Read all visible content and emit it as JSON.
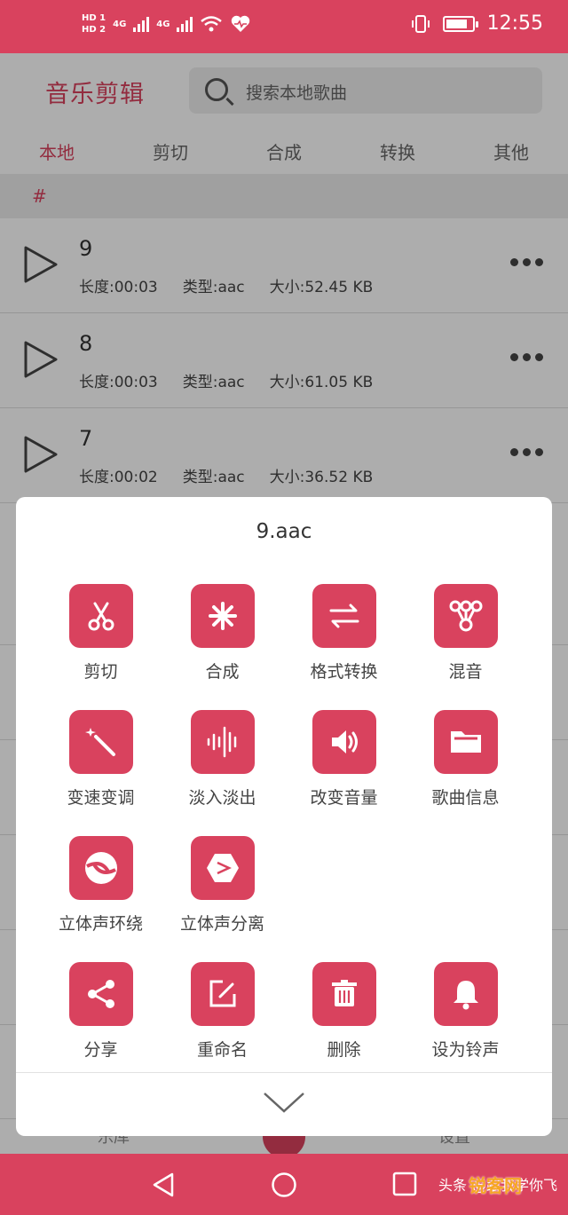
{
  "status_bar": {
    "hd1": "HD 1",
    "hd2": "HD 2",
    "net1": "4G",
    "net2": "4G",
    "battery_level": 0.85,
    "time": "12:55"
  },
  "header": {
    "title": "音乐剪辑",
    "search_placeholder": "搜索本地歌曲"
  },
  "tabs": [
    {
      "label": "本地",
      "active": true
    },
    {
      "label": "剪切",
      "active": false
    },
    {
      "label": "合成",
      "active": false
    },
    {
      "label": "转换",
      "active": false
    },
    {
      "label": "其他",
      "active": false
    }
  ],
  "section_index": "#",
  "songs": [
    {
      "name": "9",
      "length": "长度:00:03",
      "type": "类型:aac",
      "size": "大小:52.45 KB"
    },
    {
      "name": "8",
      "length": "长度:00:03",
      "type": "类型:aac",
      "size": "大小:61.05 KB"
    },
    {
      "name": "7",
      "length": "长度:00:02",
      "type": "类型:aac",
      "size": "大小:36.52 KB"
    }
  ],
  "bottom_nav": {
    "left": "乐库",
    "right": "设置"
  },
  "sheet": {
    "title": "9.aac",
    "actions": [
      {
        "label": "剪切",
        "icon": "scissors-icon"
      },
      {
        "label": "合成",
        "icon": "asterisk-icon"
      },
      {
        "label": "格式转换",
        "icon": "swap-arrows-icon"
      },
      {
        "label": "混音",
        "icon": "mix-nodes-icon"
      },
      {
        "label": "变速变调",
        "icon": "magic-wand-icon"
      },
      {
        "label": "淡入淡出",
        "icon": "waveform-icon"
      },
      {
        "label": "改变音量",
        "icon": "speaker-icon"
      },
      {
        "label": "歌曲信息",
        "icon": "folder-icon"
      },
      {
        "label": "立体声环绕",
        "icon": "surround-icon"
      },
      {
        "label": "立体声分离",
        "icon": "split-box-icon"
      },
      {
        "label": "分享",
        "icon": "share-icon"
      },
      {
        "label": "重命名",
        "icon": "edit-icon"
      },
      {
        "label": "删除",
        "icon": "trash-icon"
      },
      {
        "label": "设为铃声",
        "icon": "bell-icon"
      }
    ]
  },
  "watermark": {
    "logo": "锐客网",
    "prefix": "头条",
    "author": "@跟我学你飞"
  },
  "colors": {
    "accent": "#d9425e"
  }
}
